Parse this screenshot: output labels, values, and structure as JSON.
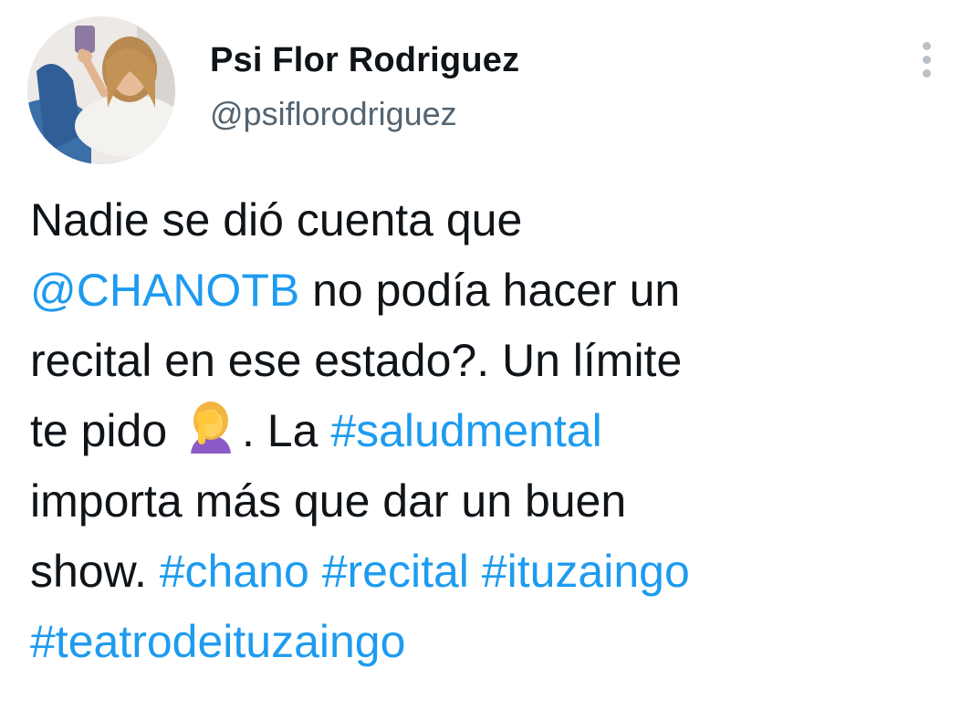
{
  "author": {
    "display_name": "Psi Flor Rodriguez",
    "handle": "@psiflorodriguez"
  },
  "tweet": {
    "lines": [
      [
        {
          "text": "Nadie se dió cuenta que",
          "type": "text"
        }
      ],
      [
        {
          "text": "@CHANOTB",
          "type": "mention"
        },
        {
          "text": " no podía hacer un",
          "type": "text"
        }
      ],
      [
        {
          "text": "recital en ese estado?. Un límite",
          "type": "text"
        }
      ],
      [
        {
          "text": "te pido ",
          "type": "text"
        },
        {
          "text": "face-palm-emoji",
          "type": "emoji"
        },
        {
          "text": ". La ",
          "type": "text"
        },
        {
          "text": "#saludmental",
          "type": "hashtag"
        }
      ],
      [
        {
          "text": "importa más que dar un buen",
          "type": "text"
        }
      ],
      [
        {
          "text": "show. ",
          "type": "text"
        },
        {
          "text": "#chano",
          "type": "hashtag"
        },
        {
          "text": " ",
          "type": "text"
        },
        {
          "text": "#recital",
          "type": "hashtag"
        },
        {
          "text": " ",
          "type": "text"
        },
        {
          "text": "#ituzaingo",
          "type": "hashtag"
        }
      ],
      [
        {
          "text": "#teatrodeituzaingo",
          "type": "hashtag"
        }
      ]
    ]
  },
  "icons": {
    "more": "more-vertical-icon"
  },
  "colors": {
    "link": "#1d9bf0",
    "text": "#0f1419",
    "secondary": "#536471"
  }
}
